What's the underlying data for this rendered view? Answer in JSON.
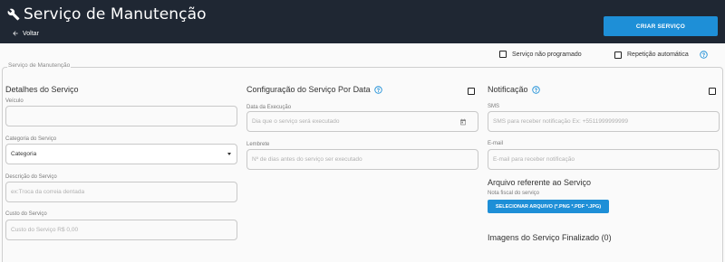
{
  "header": {
    "title": "Serviço de Manutenção",
    "back_label": "Voltar",
    "create_button": "CRIAR SERVIÇO"
  },
  "options": {
    "unscheduled_label": "Serviço não programado",
    "repeat_label": "Repetição automática"
  },
  "fieldset_legend": "Serviço de Manutenção",
  "details": {
    "title": "Detalhes do Serviço",
    "vehicle_label": "Veículo",
    "vehicle_value": "",
    "category_label": "Categoria do Serviço",
    "category_value": "Categoria",
    "description_label": "Descrição do Serviço",
    "description_placeholder": "ex:Troca da correia dentada",
    "cost_label": "Custo do Serviço",
    "cost_placeholder": "Custo do Serviço R$ 0,00"
  },
  "config": {
    "title": "Configuração do Serviço Por Data",
    "date_label": "Data da Execução",
    "date_placeholder": "Dia que o serviço será executado",
    "reminder_label": "Lembrete",
    "reminder_placeholder": "Nº de dias antes do serviço ser executado"
  },
  "notification": {
    "title": "Notificação",
    "sms_label": "SMS",
    "sms_placeholder": "SMS para receber notificação Ex: +5511999999999",
    "email_label": "E-mail",
    "email_placeholder": "E-mail para receber notificação"
  },
  "attachment": {
    "title": "Arquivo referente ao Serviço",
    "invoice_label": "Nota fiscal do serviço",
    "upload_button": "SELECIONAR ARQUIVO (*.PNG *.PDF *.JPG)",
    "finished_images": "Imagens do Serviço Finalizado (0)"
  },
  "colors": {
    "header_bg": "#1f2733",
    "accent": "#1e8fd7"
  }
}
